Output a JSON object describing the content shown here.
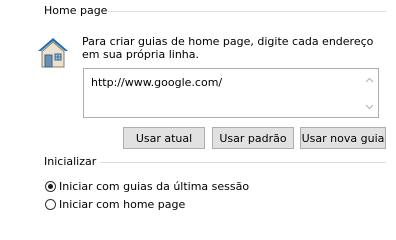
{
  "home_page": {
    "group_title": "Home page",
    "description": "Para criar guias de home page, digite cada endereço em sua própria linha.",
    "url_value": "http://www.google.com/",
    "icon": "home-icon",
    "buttons": {
      "use_current": "Usar atual",
      "use_default": "Usar padrão",
      "use_new_tab": "Usar nova guia"
    }
  },
  "startup": {
    "group_title": "Inicializar",
    "options": [
      {
        "label": "Iniciar com guias da última sessão",
        "selected": true
      },
      {
        "label": "Iniciar com home page",
        "selected": false
      }
    ]
  }
}
